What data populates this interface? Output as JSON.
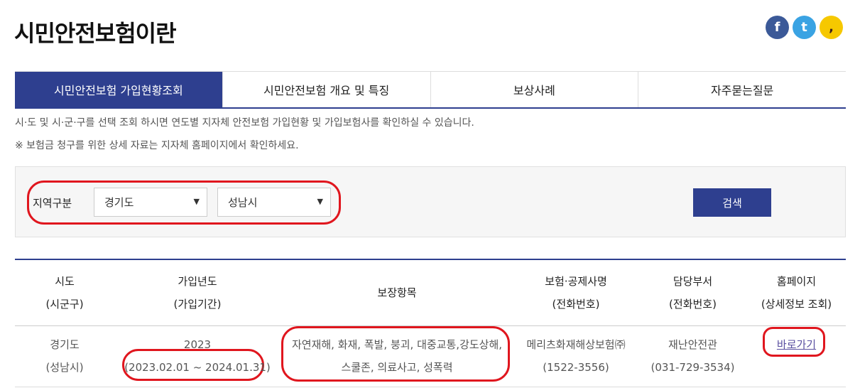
{
  "page": {
    "title": "시민안전보험이란"
  },
  "share": {
    "facebook": "f",
    "twitter": "t",
    "kakaostory": ","
  },
  "tabs": [
    {
      "label": "시민안전보험 가입현황조회",
      "active": true
    },
    {
      "label": "시민안전보험 개요 및 특징",
      "active": false
    },
    {
      "label": "보상사례",
      "active": false
    },
    {
      "label": "자주묻는질문",
      "active": false
    }
  ],
  "desc": {
    "line1": "시·도 및 시·군·구를 선택 조회 하시면 연도별 지자체 안전보험 가입현황 및 가입보험사를 확인하실 수 있습니다.",
    "line2": "※ 보험금 청구를 위한 상세 자료는 지자체 홈페이지에서 확인하세요."
  },
  "search": {
    "label": "지역구분",
    "sido": "경기도",
    "sigungu": "성남시",
    "button": "검색"
  },
  "table": {
    "headers": [
      {
        "line1": "시도",
        "line2": "(시군구)"
      },
      {
        "line1": "가입년도",
        "line2": "(가입기간)"
      },
      {
        "line1": "보장항목",
        "line2": ""
      },
      {
        "line1": "보험·공제사명",
        "line2": "(전화번호)"
      },
      {
        "line1": "담당부서",
        "line2": "(전화번호)"
      },
      {
        "line1": "홈페이지",
        "line2": "(상세정보 조회)"
      }
    ],
    "rows": [
      {
        "sido": "경기도",
        "sigungu": "(성남시)",
        "year": "2023",
        "period": "(2023.02.01 ~ 2024.01.31)",
        "coverage1": "자연재해, 화재, 폭발, 붕괴, 대중교통,강도상해,",
        "coverage2": "스쿨존, 의료사고, 성폭력",
        "insurer": "메리츠화재해상보험㈜",
        "insurer_phone": "(1522-3556)",
        "dept": "재난안전관",
        "dept_phone": "(031-729-3534)",
        "link": "바로가기"
      }
    ]
  },
  "colors": {
    "primary": "#2e3f8f",
    "highlight": "#e0161e"
  }
}
